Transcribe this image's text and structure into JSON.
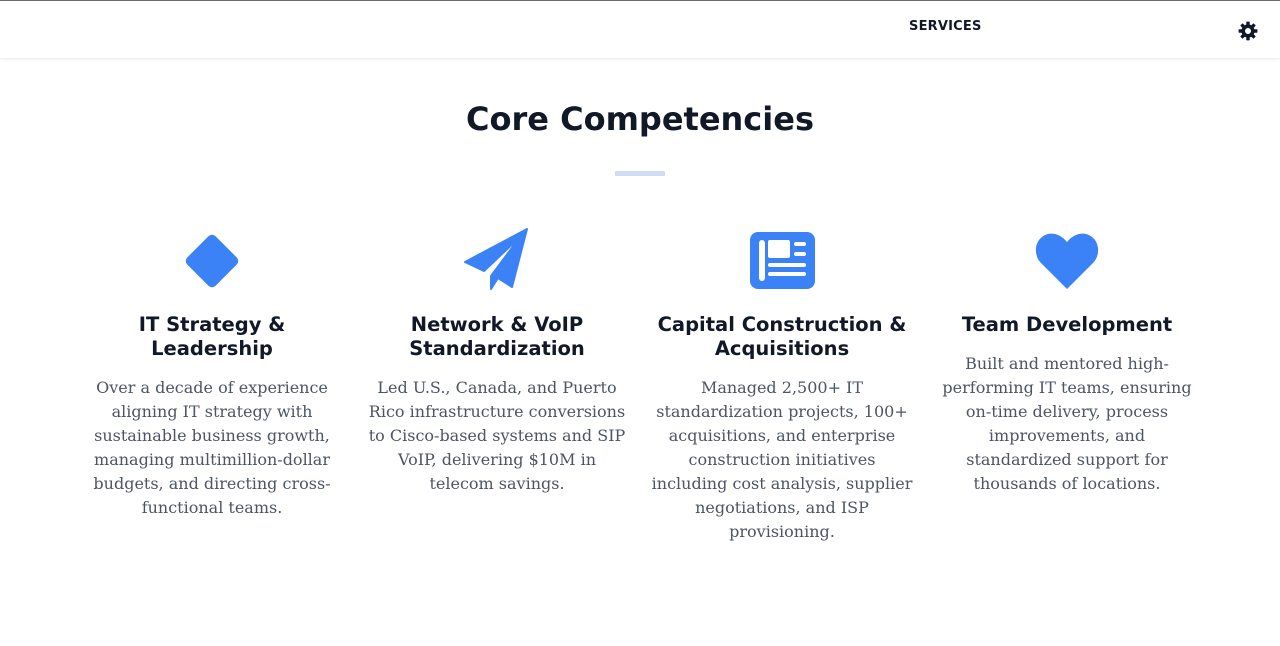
{
  "nav": {
    "services_label": "SERVICES",
    "theme_icon": "gear-icon"
  },
  "section": {
    "title": "Core Competencies"
  },
  "colors": {
    "accent": "#3b82f6",
    "divider": "#cfdcf5",
    "heading": "#111827",
    "body_text": "#4b5563"
  },
  "cards": [
    {
      "icon": "diamond-icon",
      "title": "IT Strategy & Leadership",
      "body": "Over a decade of experience aligning IT strategy with sustainable business growth, managing multimillion-dollar budgets, and directing cross-functional teams."
    },
    {
      "icon": "paper-plane-icon",
      "title": "Network & VoIP Standardization",
      "body": "Led U.S., Canada, and Puerto Rico infrastructure conversions to Cisco-based systems and SIP VoIP, delivering $10M in telecom savings."
    },
    {
      "icon": "newspaper-icon",
      "title": "Capital Construction & Acquisitions",
      "body": "Managed 2,500+ IT standardization projects, 100+ acquisitions, and enterprise construction initiatives including cost analysis, supplier negotiations, and ISP provisioning."
    },
    {
      "icon": "heart-icon",
      "title": "Team Development",
      "body": "Built and mentored high-performing IT teams, ensuring on-time delivery, process improvements, and standardized support for thousands of locations."
    }
  ]
}
